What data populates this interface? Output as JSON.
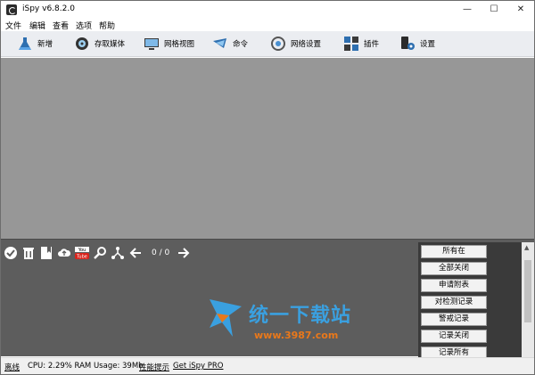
{
  "window": {
    "title": "iSpy v6.8.2.0"
  },
  "menu": [
    "文件",
    "编辑",
    "查看",
    "选项",
    "帮助"
  ],
  "toolbar": [
    {
      "label": "新增",
      "icon": "add-flask-icon"
    },
    {
      "label": "存取媒体",
      "icon": "media-icon"
    },
    {
      "label": "网格视图",
      "icon": "grid-view-icon"
    },
    {
      "label": "命令",
      "icon": "command-icon"
    },
    {
      "label": "网络设置",
      "icon": "network-icon"
    },
    {
      "label": "插件",
      "icon": "plugins-icon"
    },
    {
      "label": "设置",
      "icon": "settings-icon"
    }
  ],
  "bottom_toolbar": {
    "page_counter": "0 / 0"
  },
  "side_buttons": [
    "所有在",
    "全部关闭",
    "申请附表",
    "对检测记录",
    "警戒记录",
    "记录关闭",
    "记录所有"
  ],
  "watermark": {
    "text": "统一下载站",
    "url": "www.3987.com"
  },
  "status": {
    "offline": "离线",
    "usage": "CPU: 2.29% RAM Usage: 39Mb",
    "perf_tips": "性能提示",
    "get_pro": "Get iSpy PRO"
  },
  "colors": {
    "video_bg": "#979797",
    "panel_bg": "#5d5d5d",
    "toolbar_bg": "#ebedf1",
    "watermark_blue": "#3aa0e0",
    "watermark_orange": "#e9781a"
  }
}
